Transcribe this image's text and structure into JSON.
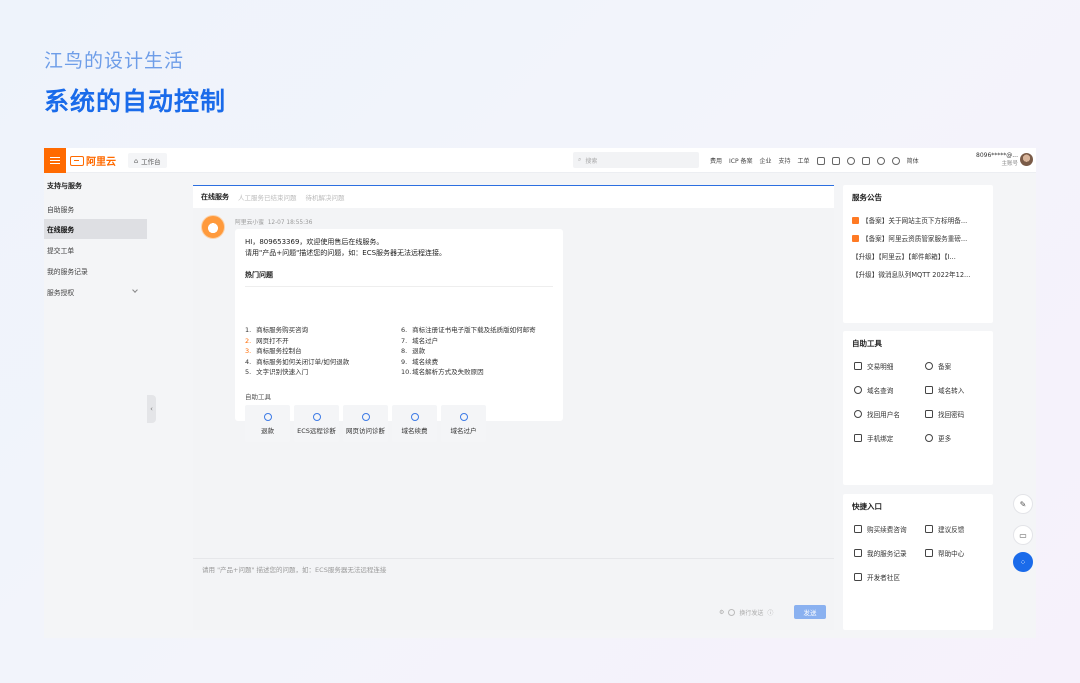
{
  "header": {
    "brand": "江鸟的设计生活",
    "headline": "系统的自动控制"
  },
  "topbar": {
    "logo_text": "阿里云",
    "workbench": "工作台",
    "search_placeholder": "搜索",
    "links": [
      "费用",
      "ICP 备案",
      "企业",
      "支持",
      "工单"
    ],
    "simplified": "简体",
    "account_name": "8096*****@...",
    "account_sub": "主账号"
  },
  "sidebar": {
    "heading": "支持与服务",
    "items": [
      {
        "label": "自助服务"
      },
      {
        "label": "在线服务"
      },
      {
        "label": "提交工单"
      },
      {
        "label": "我的服务记录"
      },
      {
        "label": "服务授权"
      }
    ],
    "collapse_glyph": "‹"
  },
  "chat": {
    "tabs": [
      "在线服务",
      "人工服务已结束问题",
      "待机解决问题"
    ],
    "bot_name": "阿里云小蜜",
    "timestamp": "12-07 18:55:36",
    "greeting_line1": "HI，809653369，欢迎使用售后在线服务。",
    "greeting_line2": "请用\"产品+问题\"描述您的问题，如：ECS服务器无法远程连接。",
    "hot_title": "热门问题",
    "questions_left": [
      {
        "n": "1.",
        "text": "商标服务购买咨询"
      },
      {
        "n": "2.",
        "text": "网页打不开"
      },
      {
        "n": "3.",
        "text": "商标服务控制台"
      },
      {
        "n": "4.",
        "text": "商标服务如何关闭订单/如何退款"
      },
      {
        "n": "5.",
        "text": "文字识别快速入门"
      }
    ],
    "questions_right": [
      {
        "n": "6.",
        "text": "商标注册证书电子版下载及纸质版如何邮寄"
      },
      {
        "n": "7.",
        "text": "域名过户"
      },
      {
        "n": "8.",
        "text": "退款"
      },
      {
        "n": "9.",
        "text": "域名续费"
      },
      {
        "n": "10.",
        "text": "域名解析方式及失败原因"
      }
    ],
    "tools_title": "自助工具",
    "tools": [
      "退款",
      "ECS远程诊断",
      "网页访问诊断",
      "域名续费",
      "域名过户"
    ],
    "composer_placeholder": "请用 \"产品+问题\" 描述您的问题，如：ECS服务器无法远程连接",
    "enter_option": "换行发送",
    "send_label": "发送"
  },
  "notices": {
    "title": "服务公告",
    "items": [
      "【备案】关于网站主页下方标明备...",
      "【备案】阿里云资质管家服务重磅...",
      "【升级】【阿里云】【邮件邮箱】【I...",
      "【升级】微消息队列MQTT 2022年12..."
    ]
  },
  "self_tools": {
    "title": "自助工具",
    "items": [
      "交易明细",
      "备案",
      "域名查询",
      "域名转入",
      "找回用户名",
      "找回密码",
      "手机绑定",
      "更多"
    ]
  },
  "quick": {
    "title": "快捷入口",
    "items": [
      "购买续费咨询",
      "建议反馈",
      "我的服务记录",
      "帮助中心",
      "开发者社区"
    ]
  },
  "fabs": [
    "✎",
    "▭",
    "⁘"
  ],
  "colors": {
    "accent": "#1a6bea",
    "brand_orange": "#ff6a00",
    "headline": "#1a6bea"
  }
}
